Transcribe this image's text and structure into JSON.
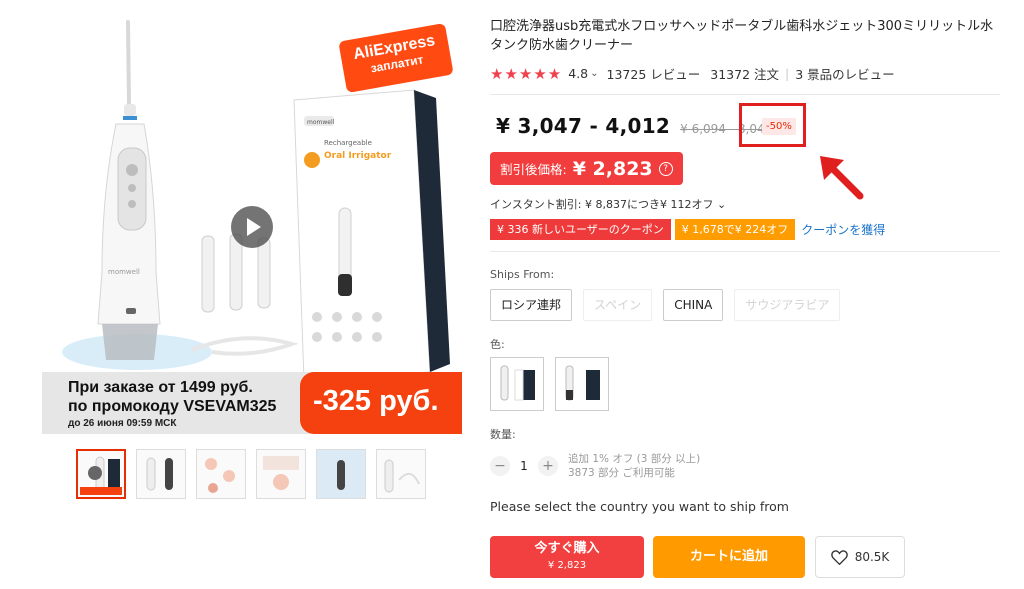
{
  "gallery": {
    "badge": {
      "line1": "AliExpress",
      "line2": "заплатит"
    },
    "promo": {
      "line1": "При заказе от 1499 руб.",
      "line2": "по промокоду VSEVAM325",
      "line3": "до 26 июня 09:59 МСК",
      "amount": "-325 руб."
    },
    "box_brand": "momwell",
    "box_text1": "Rechargeable",
    "box_text2": "Oral Irrigator",
    "device_brand": "momwell",
    "thumbnail_count": 6
  },
  "product": {
    "title": "口腔洗浄器usb充電式水フロッサヘッドポータブル歯科水ジェット300ミリリットル水タンク防水歯クリーナー",
    "stars": "★★★★★",
    "rating": "4.8",
    "rating_caret": "⌄",
    "reviews": "13725 レビュー",
    "orders": "31372 注文",
    "store_reviews": "3 景品のレビュー"
  },
  "price": {
    "range": "¥ 3,047 - 4,012",
    "original": "¥ 6,094 - 8,046",
    "discount": "-50%"
  },
  "sale": {
    "label": "割引後価格:",
    "value": "¥ 2,823",
    "help": "?"
  },
  "instant_discount": "インスタント割引: ¥ 8,837につき¥ 112オフ ⌄",
  "coupons": {
    "new_user": "¥ 336 新しいユーザーのクーポン",
    "threshold": "¥ 1,678で¥ 224オフ",
    "get_link": "クーポンを獲得"
  },
  "ships_from": {
    "label": "Ships From:",
    "options": [
      "ロシア連邦",
      "スペイン",
      "CHINA",
      "サウジアラビア"
    ]
  },
  "color": {
    "label": "色:"
  },
  "quantity": {
    "label": "数量:",
    "minus": "−",
    "value": "1",
    "plus": "+",
    "note1": "追加 1% オフ (3 部分 以上)",
    "note2": "3873 部分 ご利用可能"
  },
  "ship_message": "Please select the country you want to ship from",
  "actions": {
    "buy_now": "今すぐ購入",
    "buy_price": "¥ 2,823",
    "add_to_cart": "カートに追加",
    "wishlist_count": "80.5K"
  },
  "colors": {
    "accent_red": "#f23f3f",
    "orange": "#ff9a00",
    "annotation": "#e0201f",
    "link": "#1a73c8"
  }
}
